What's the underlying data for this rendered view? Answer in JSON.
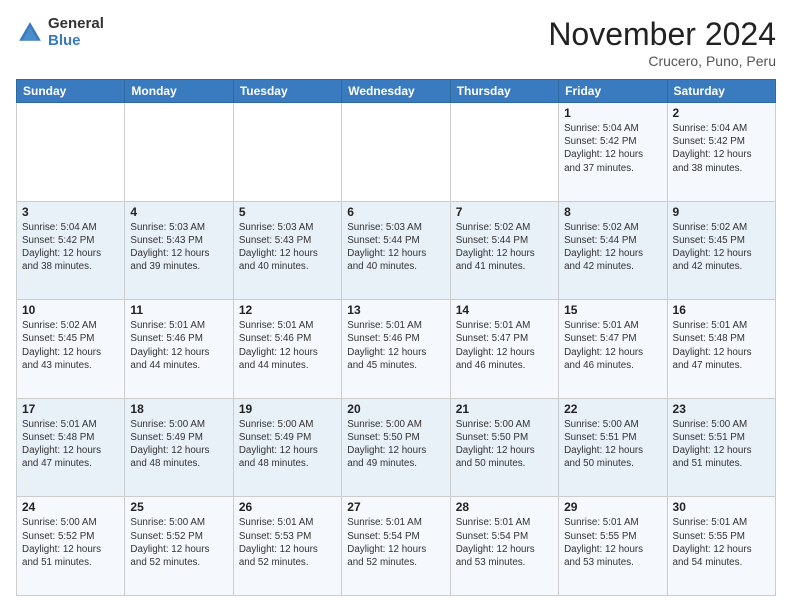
{
  "logo": {
    "general": "General",
    "blue": "Blue"
  },
  "header": {
    "title": "November 2024",
    "location": "Crucero, Puno, Peru"
  },
  "weekdays": [
    "Sunday",
    "Monday",
    "Tuesday",
    "Wednesday",
    "Thursday",
    "Friday",
    "Saturday"
  ],
  "weeks": [
    [
      {
        "day": "",
        "info": ""
      },
      {
        "day": "",
        "info": ""
      },
      {
        "day": "",
        "info": ""
      },
      {
        "day": "",
        "info": ""
      },
      {
        "day": "",
        "info": ""
      },
      {
        "day": "1",
        "info": "Sunrise: 5:04 AM\nSunset: 5:42 PM\nDaylight: 12 hours\nand 37 minutes."
      },
      {
        "day": "2",
        "info": "Sunrise: 5:04 AM\nSunset: 5:42 PM\nDaylight: 12 hours\nand 38 minutes."
      }
    ],
    [
      {
        "day": "3",
        "info": "Sunrise: 5:04 AM\nSunset: 5:42 PM\nDaylight: 12 hours\nand 38 minutes."
      },
      {
        "day": "4",
        "info": "Sunrise: 5:03 AM\nSunset: 5:43 PM\nDaylight: 12 hours\nand 39 minutes."
      },
      {
        "day": "5",
        "info": "Sunrise: 5:03 AM\nSunset: 5:43 PM\nDaylight: 12 hours\nand 40 minutes."
      },
      {
        "day": "6",
        "info": "Sunrise: 5:03 AM\nSunset: 5:44 PM\nDaylight: 12 hours\nand 40 minutes."
      },
      {
        "day": "7",
        "info": "Sunrise: 5:02 AM\nSunset: 5:44 PM\nDaylight: 12 hours\nand 41 minutes."
      },
      {
        "day": "8",
        "info": "Sunrise: 5:02 AM\nSunset: 5:44 PM\nDaylight: 12 hours\nand 42 minutes."
      },
      {
        "day": "9",
        "info": "Sunrise: 5:02 AM\nSunset: 5:45 PM\nDaylight: 12 hours\nand 42 minutes."
      }
    ],
    [
      {
        "day": "10",
        "info": "Sunrise: 5:02 AM\nSunset: 5:45 PM\nDaylight: 12 hours\nand 43 minutes."
      },
      {
        "day": "11",
        "info": "Sunrise: 5:01 AM\nSunset: 5:46 PM\nDaylight: 12 hours\nand 44 minutes."
      },
      {
        "day": "12",
        "info": "Sunrise: 5:01 AM\nSunset: 5:46 PM\nDaylight: 12 hours\nand 44 minutes."
      },
      {
        "day": "13",
        "info": "Sunrise: 5:01 AM\nSunset: 5:46 PM\nDaylight: 12 hours\nand 45 minutes."
      },
      {
        "day": "14",
        "info": "Sunrise: 5:01 AM\nSunset: 5:47 PM\nDaylight: 12 hours\nand 46 minutes."
      },
      {
        "day": "15",
        "info": "Sunrise: 5:01 AM\nSunset: 5:47 PM\nDaylight: 12 hours\nand 46 minutes."
      },
      {
        "day": "16",
        "info": "Sunrise: 5:01 AM\nSunset: 5:48 PM\nDaylight: 12 hours\nand 47 minutes."
      }
    ],
    [
      {
        "day": "17",
        "info": "Sunrise: 5:01 AM\nSunset: 5:48 PM\nDaylight: 12 hours\nand 47 minutes."
      },
      {
        "day": "18",
        "info": "Sunrise: 5:00 AM\nSunset: 5:49 PM\nDaylight: 12 hours\nand 48 minutes."
      },
      {
        "day": "19",
        "info": "Sunrise: 5:00 AM\nSunset: 5:49 PM\nDaylight: 12 hours\nand 48 minutes."
      },
      {
        "day": "20",
        "info": "Sunrise: 5:00 AM\nSunset: 5:50 PM\nDaylight: 12 hours\nand 49 minutes."
      },
      {
        "day": "21",
        "info": "Sunrise: 5:00 AM\nSunset: 5:50 PM\nDaylight: 12 hours\nand 50 minutes."
      },
      {
        "day": "22",
        "info": "Sunrise: 5:00 AM\nSunset: 5:51 PM\nDaylight: 12 hours\nand 50 minutes."
      },
      {
        "day": "23",
        "info": "Sunrise: 5:00 AM\nSunset: 5:51 PM\nDaylight: 12 hours\nand 51 minutes."
      }
    ],
    [
      {
        "day": "24",
        "info": "Sunrise: 5:00 AM\nSunset: 5:52 PM\nDaylight: 12 hours\nand 51 minutes."
      },
      {
        "day": "25",
        "info": "Sunrise: 5:00 AM\nSunset: 5:52 PM\nDaylight: 12 hours\nand 52 minutes."
      },
      {
        "day": "26",
        "info": "Sunrise: 5:01 AM\nSunset: 5:53 PM\nDaylight: 12 hours\nand 52 minutes."
      },
      {
        "day": "27",
        "info": "Sunrise: 5:01 AM\nSunset: 5:54 PM\nDaylight: 12 hours\nand 52 minutes."
      },
      {
        "day": "28",
        "info": "Sunrise: 5:01 AM\nSunset: 5:54 PM\nDaylight: 12 hours\nand 53 minutes."
      },
      {
        "day": "29",
        "info": "Sunrise: 5:01 AM\nSunset: 5:55 PM\nDaylight: 12 hours\nand 53 minutes."
      },
      {
        "day": "30",
        "info": "Sunrise: 5:01 AM\nSunset: 5:55 PM\nDaylight: 12 hours\nand 54 minutes."
      }
    ]
  ]
}
